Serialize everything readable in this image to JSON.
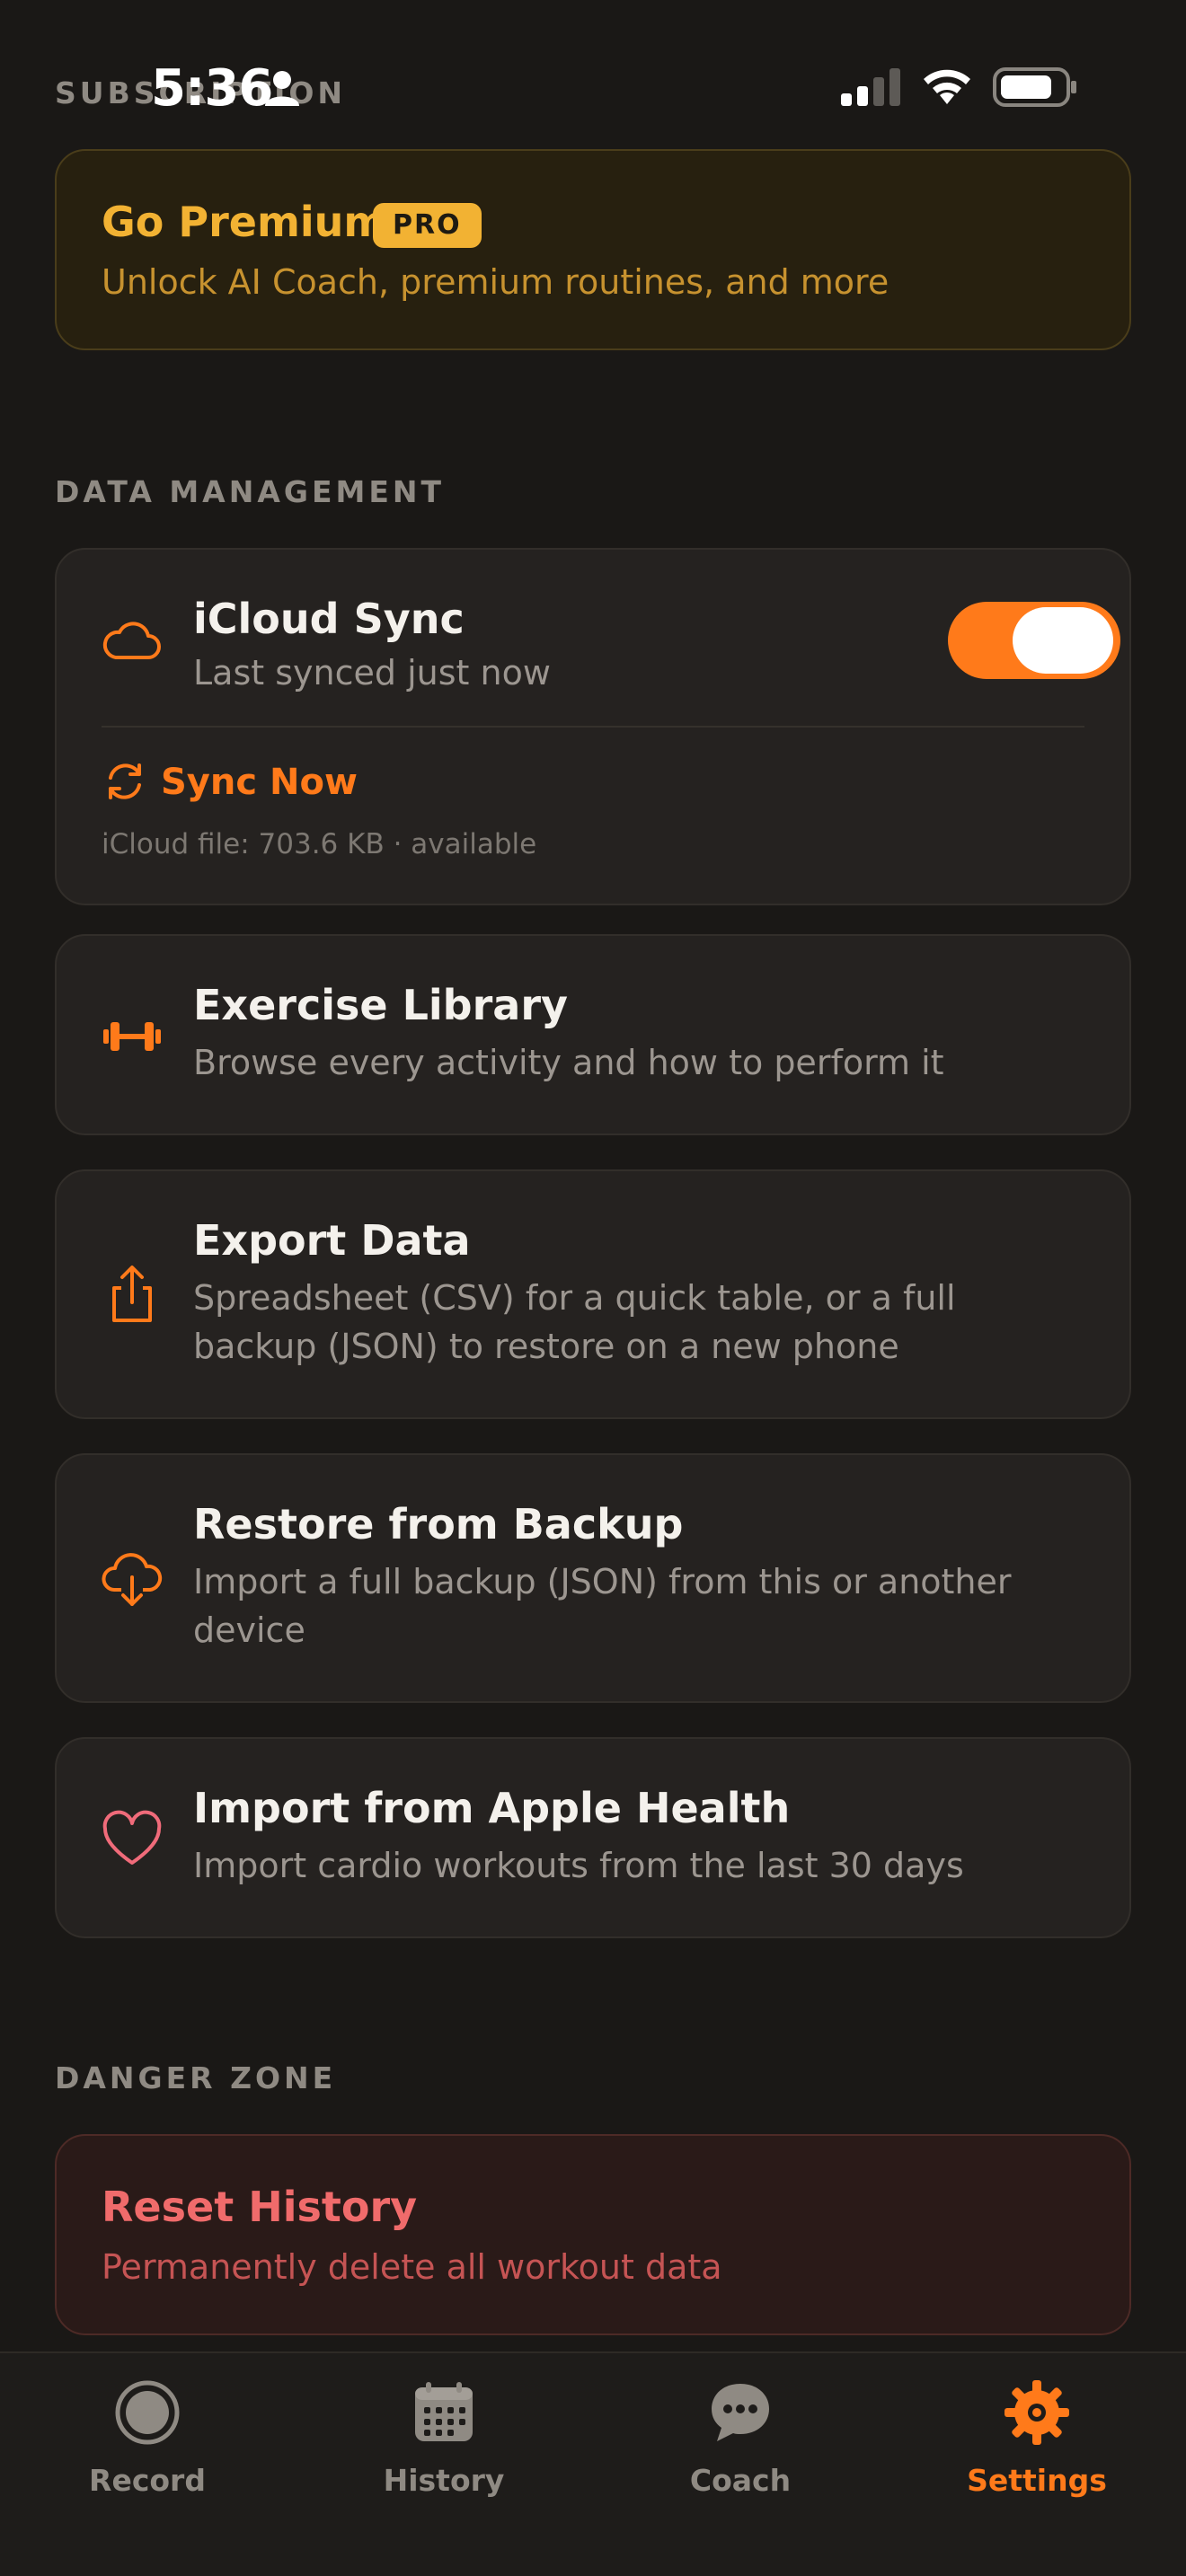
{
  "status_bar": {
    "time": "5:36"
  },
  "sections": {
    "subscription": "SUBSCRIPTION",
    "data_management": "DATA MANAGEMENT",
    "danger_zone": "DANGER ZONE"
  },
  "premium": {
    "title": "Go Premium",
    "badge": "PRO",
    "subtitle": "Unlock AI Coach, premium routines, and more"
  },
  "icloud": {
    "title": "iCloud Sync",
    "subtitle": "Last synced just now",
    "toggle_on": true,
    "sync_now": "Sync Now",
    "file_info": "iCloud file: 703.6 KB · available"
  },
  "rows": [
    {
      "title": "Exercise Library",
      "subtitle": "Browse every activity and how to perform it",
      "icon": "dumbbell-icon"
    },
    {
      "title": "Export Data",
      "subtitle": "Spreadsheet (CSV) for a quick table, or a full backup (JSON) to restore on a new phone",
      "icon": "share-icon"
    },
    {
      "title": "Restore from Backup",
      "subtitle": "Import a full backup (JSON) from this or another device",
      "icon": "cloud-download-icon"
    },
    {
      "title": "Import from Apple Health",
      "subtitle": "Import cardio workouts from the last 30 days",
      "icon": "heart-icon"
    }
  ],
  "danger": {
    "title": "Reset History",
    "subtitle": "Permanently delete all workout data"
  },
  "tabs": [
    {
      "label": "Record",
      "icon": "record-icon"
    },
    {
      "label": "History",
      "icon": "calendar-icon"
    },
    {
      "label": "Coach",
      "icon": "chat-bubble-icon"
    },
    {
      "label": "Settings",
      "icon": "gear-icon",
      "active": true
    }
  ],
  "colors": {
    "accent": "#ff7a1a",
    "premium": "#f2b233",
    "danger": "#f06b6b",
    "background": "#1a1816"
  }
}
